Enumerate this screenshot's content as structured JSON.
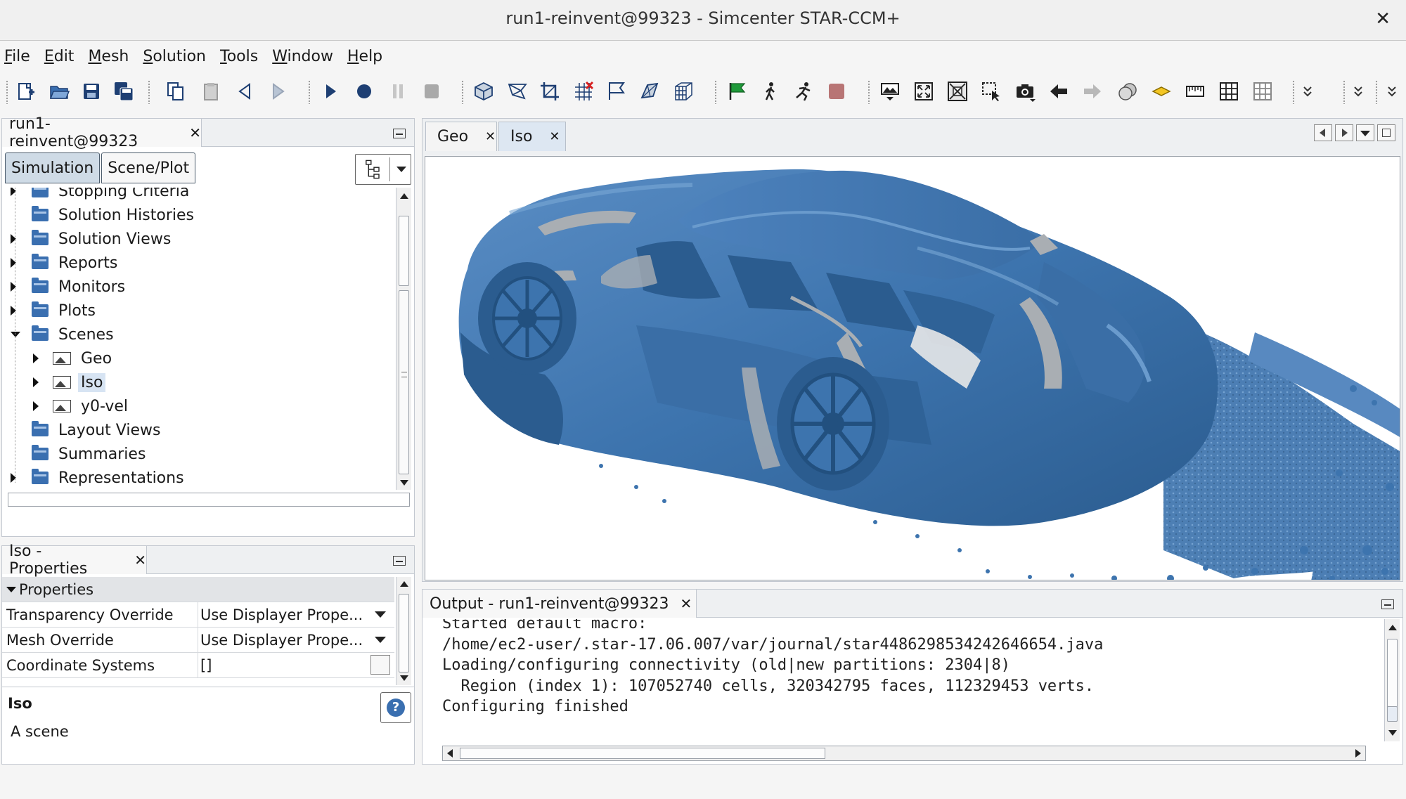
{
  "window": {
    "title": "run1-reinvent@99323 - Simcenter STAR-CCM+",
    "close_glyph": "✕"
  },
  "menu": [
    {
      "label": "File",
      "mnemonic": "F",
      "rest": "ile"
    },
    {
      "label": "Edit",
      "mnemonic": "E",
      "rest": "dit"
    },
    {
      "label": "Mesh",
      "mnemonic": "M",
      "rest": "esh"
    },
    {
      "label": "Solution",
      "mnemonic": "S",
      "rest": "olution"
    },
    {
      "label": "Tools",
      "mnemonic": "T",
      "rest": "ools"
    },
    {
      "label": "Window",
      "mnemonic": "W",
      "rest": "indow"
    },
    {
      "label": "Help",
      "mnemonic": "H",
      "rest": "elp"
    }
  ],
  "sim_panel": {
    "tab_label": "run1-reinvent@99323",
    "tab_close": "✕",
    "subtabs": [
      "Simulation",
      "Scene/Plot"
    ],
    "tree": [
      {
        "label": "Stopping Criteria",
        "icon": "folder-icon",
        "expand": "right",
        "level": 0,
        "partial": true
      },
      {
        "label": "Solution Histories",
        "icon": "folder-icon",
        "expand": "none",
        "level": 0
      },
      {
        "label": "Solution Views",
        "icon": "folder-icon",
        "expand": "right",
        "level": 0
      },
      {
        "label": "Reports",
        "icon": "folder-icon",
        "expand": "right",
        "level": 0
      },
      {
        "label": "Monitors",
        "icon": "folder-icon",
        "expand": "right",
        "level": 0
      },
      {
        "label": "Plots",
        "icon": "folder-icon",
        "expand": "right",
        "level": 0
      },
      {
        "label": "Scenes",
        "icon": "folder-icon",
        "expand": "down",
        "level": 0
      },
      {
        "label": "Geo",
        "icon": "scene-icon",
        "expand": "right",
        "level": 1
      },
      {
        "label": "Iso",
        "icon": "scene-icon",
        "expand": "right",
        "level": 1,
        "selected": true
      },
      {
        "label": "y0-vel",
        "icon": "scene-icon",
        "expand": "right",
        "level": 1
      },
      {
        "label": "Layout Views",
        "icon": "folder-icon",
        "expand": "none",
        "level": 0
      },
      {
        "label": "Summaries",
        "icon": "folder-icon",
        "expand": "none",
        "level": 0
      },
      {
        "label": "Representations",
        "icon": "folder-icon",
        "expand": "right",
        "level": 0
      }
    ]
  },
  "properties_panel": {
    "tab_label": "Iso - Properties",
    "tab_close": "✕",
    "section": "Properties",
    "rows": [
      {
        "key": "Transparency Override",
        "value": "Use Displayer Prope...",
        "control": "dropdown"
      },
      {
        "key": "Mesh Override",
        "value": "Use Displayer Prope...",
        "control": "dropdown"
      },
      {
        "key": "Coordinate Systems",
        "value": "[]",
        "control": "ellipsis"
      }
    ],
    "help_title": "Iso",
    "help_text": "A scene",
    "help_icon": "?"
  },
  "scene_tabs": [
    {
      "label": "Geo",
      "active": false
    },
    {
      "label": "Iso",
      "active": true
    }
  ],
  "tab_close": "✕",
  "output": {
    "tab_label": "Output - run1-reinvent@99323",
    "lines": [
      "Started default macro:",
      "/home/ec2-user/.star-17.06.007/var/journal/star4486298534242646654.java",
      "Loading/configuring connectivity (old|new partitions: 2304|8)",
      "  Region (index 1): 107052740 cells, 320342795 faces, 112329453 verts.",
      "Configuring finished"
    ]
  },
  "colors": {
    "car_body": "#3d74ae",
    "car_dark": "#2b5c8f",
    "car_highlight": "#6a9bcd",
    "car_gray": "#a9aeb3",
    "accent_selected": "#d7e4f3"
  }
}
